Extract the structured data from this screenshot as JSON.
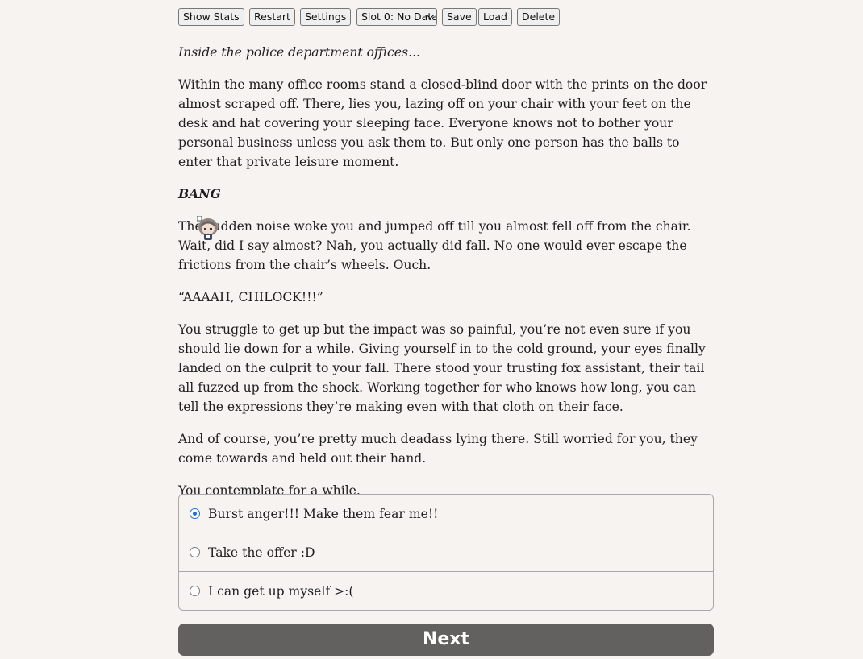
{
  "toolbar": {
    "show_stats": "Show Stats",
    "restart": "Restart",
    "settings": "Settings",
    "slot_selected": "Slot 0: No Data",
    "save": "Save",
    "load": "Load",
    "delete": "Delete"
  },
  "story": {
    "p1": "Inside the police department offices...",
    "p2": "Within the many office rooms stand a closed-blind door with the prints on the door almost scraped off. There, lies you, lazing off on your chair with your feet on the desk and hat covering your sleeping face. Everyone knows not to bother your personal business unless you ask them to. But only one person has the balls to enter that private leisure moment.",
    "p3": "BANG",
    "p4": "The sudden noise woke you and jumped off till you almost fell off from the chair. Wait, did I say almost? Nah, you actually did fall. No one would ever escape the frictions from the chair’s wheels. Ouch.",
    "p5": "“AAAAH, CHILOCK!!!”",
    "p6": "You struggle to get up but the impact was so painful, you’re not even sure if you should lie down for a while. Giving yourself in to the cold ground, your eyes finally landed on the culprit to your fall. There stood your trusting fox assistant, their tail all fuzzed up from the shock. Working together for who knows how long, you can tell the expressions they’re making even with that cloth on their face.",
    "p7": "And of course, you’re pretty much deadass lying there. Still worried for you, they come towards and held out their hand.",
    "p8": "You contemplate for a while."
  },
  "choices": [
    {
      "label": "Burst anger!!! Make them fear me!!",
      "selected": true
    },
    {
      "label": "Take the offer :D",
      "selected": false
    },
    {
      "label": "I can get up myself >:(",
      "selected": false
    }
  ],
  "next_label": "Next",
  "sprite_icon": "chibi-character-icon"
}
